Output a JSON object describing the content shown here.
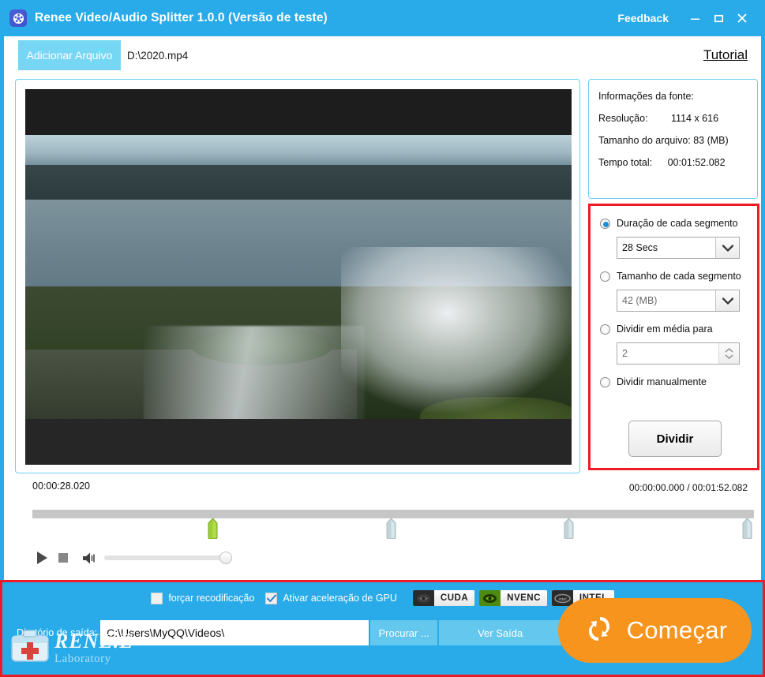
{
  "window": {
    "app_icon": "film-reel-icon",
    "title": "Renee Video/Audio Splitter 1.0.0 (Versão de teste)",
    "feedback_label": "Feedback",
    "minimize_icon": "minimize-icon",
    "maximize_icon": "maximize-icon",
    "close_icon": "close-icon",
    "accent_blue": "#29ABE9"
  },
  "file_row": {
    "add_file_label": "Adicionar Arquivo",
    "file_path": "D:\\2020.mp4",
    "tutorial_label": "Tutorial"
  },
  "source_info": {
    "heading": "Informações da fonte:",
    "resolution_label": "Resolução:",
    "resolution_value": "1114 x 616",
    "filesize_label": "Tamanho do arquivo:",
    "filesize_value": "83 (MB)",
    "duration_label": "Tempo total:",
    "duration_value": "00:01:52.082"
  },
  "split_options": {
    "highlight_color": "#ED1C24",
    "options": [
      {
        "label": "Duração de cada segmento",
        "selected": true
      },
      {
        "label": "Tamanho de cada segmento",
        "selected": false
      },
      {
        "label": "Dividir em média para",
        "selected": false
      },
      {
        "label": "Dividir manualmente",
        "selected": false
      }
    ],
    "duration_value": "28 Secs",
    "size_value": "42 (MB)",
    "average_value": "2",
    "split_button_label": "Dividir"
  },
  "player": {
    "current_marker_time": "00:00:28.020",
    "position_and_total": "00:00:00.000 / 00:01:52.082",
    "play_icon": "play-icon",
    "stop_icon": "stop-icon",
    "volume_icon": "volume-icon",
    "markers": [
      {
        "position_pct": 25.0,
        "active": true
      },
      {
        "position_pct": 49.7,
        "active": false
      },
      {
        "position_pct": 74.3,
        "active": false
      },
      {
        "position_pct": 98.9,
        "active": false
      }
    ],
    "volume_pct": 100
  },
  "bottom_bar": {
    "force_reencode_label": "forçar recodificação",
    "force_reencode_checked": false,
    "gpu_accel_label": "Ativar aceleração de GPU",
    "gpu_accel_checked": true,
    "gpu_badges": [
      {
        "name": "CUDA",
        "icon": "nvidia-eye-icon",
        "enabled": false
      },
      {
        "name": "NVENC",
        "icon": "nvidia-eye-icon",
        "enabled": true
      },
      {
        "name": "INTEL",
        "icon": "intel-oval-icon",
        "enabled": false
      }
    ],
    "output_dir_label": "Diretório de saída:",
    "output_dir_value": "C:\\Users\\MyQQ\\Videos\\",
    "browse_label": "Procurar ...",
    "view_output_label": "Ver Saída",
    "start_label": "Começar",
    "start_icon": "refresh-swap-icon",
    "start_color": "#F7941E"
  },
  "watermark": {
    "icon": "first-aid-kit-icon",
    "brand": "RENE.E",
    "sub": "Laboratory"
  }
}
